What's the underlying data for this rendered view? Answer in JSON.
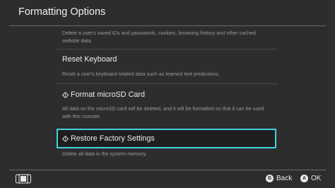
{
  "header": {
    "title": "Formatting Options"
  },
  "items": [
    {
      "label": "",
      "description": "Delete a user's saved IDs and passwords, cookies, browsing history and other cached website data."
    },
    {
      "label": "Reset Keyboard",
      "description": "Reset a user's keyboard-related data such as learned text predictions."
    },
    {
      "label": "Format microSD Card",
      "description": "All data on the microSD card will be deleted, and it will be formatted so that it can be used with this console."
    },
    {
      "label": "Restore Factory Settings",
      "description": "Delete all data in the system memory."
    }
  ],
  "footer": {
    "back_key": "B",
    "back_label": "Back",
    "ok_key": "A",
    "ok_label": "OK"
  },
  "colors": {
    "accent": "#3fd3e0",
    "background": "#2d2d2d"
  }
}
